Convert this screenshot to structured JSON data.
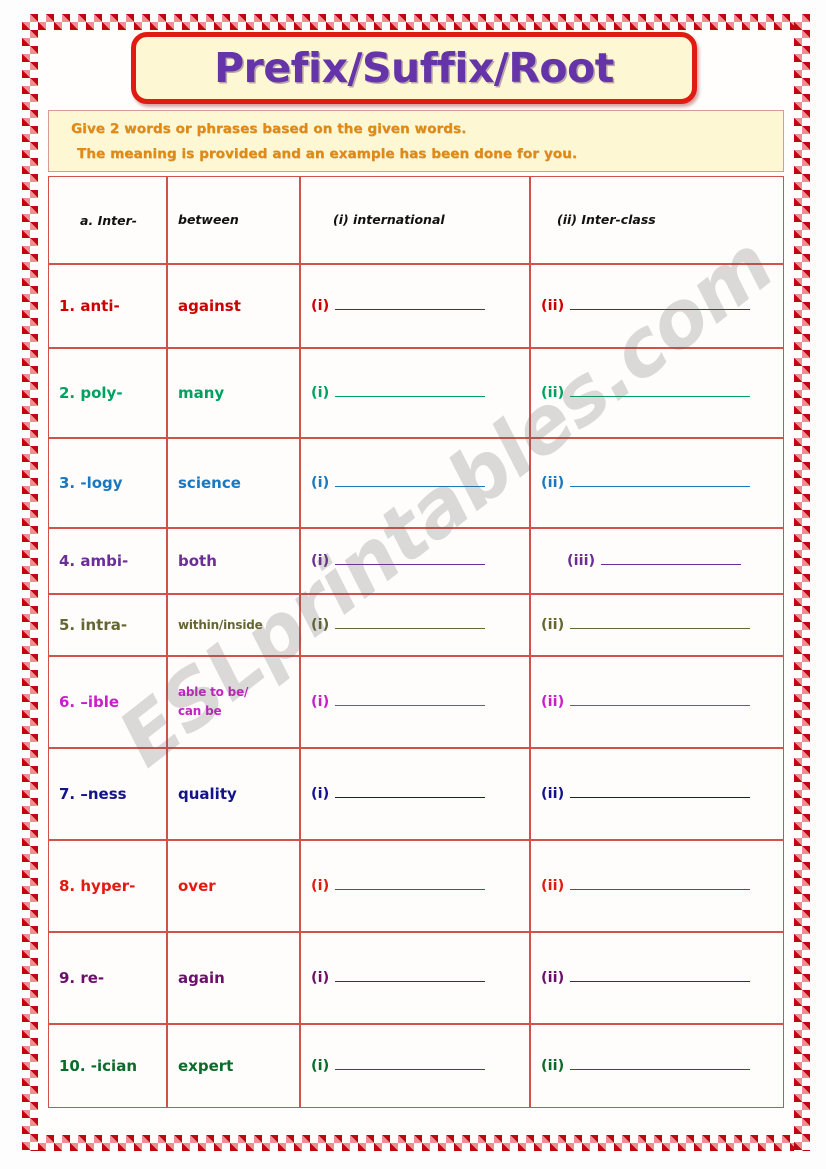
{
  "title": "Prefix/Suffix/Root",
  "instructions": {
    "line1": "Give 2 words or phrases based on the given words.",
    "line2": "The meaning is provided and an example has been done for you."
  },
  "watermark": "ESLprintables.com",
  "colors": {
    "title_purple": "#6434a8",
    "instruction_orange": "#e08a15",
    "banner_bg": "#fdf8d3",
    "banner_border": "#e01b12",
    "table_border": "#d0534a",
    "checker_dark": "#c00510",
    "checker_light": "#ef8f93"
  },
  "table": {
    "example_row": {
      "label": "a.  Inter-",
      "meaning": "between",
      "answer1": "(i)  international",
      "answer2": "(ii) Inter-class",
      "color": "#111111"
    },
    "rows": [
      {
        "number": "1. anti-",
        "meaning": "against",
        "marker1": "(i)",
        "marker2": "(ii)",
        "color": "#cc0000"
      },
      {
        "number": "2. poly-",
        "meaning": "many",
        "marker1": "(i)",
        "marker2": "(ii)",
        "color": "#00a060"
      },
      {
        "number": "3. -logy",
        "meaning": "science",
        "marker1": "(i)",
        "marker2": "(ii)",
        "color": "#1878c0"
      },
      {
        "number": "4. ambi-",
        "meaning": "both",
        "marker1": "(i)",
        "marker2": "(iii)",
        "color": "#6b2d96"
      },
      {
        "number": "5. intra-",
        "meaning": "within/inside",
        "marker1": "(i)",
        "marker2": "(ii)",
        "color": "#666633"
      },
      {
        "number": "6. –ible",
        "meaning": "able to be/\ncan be",
        "marker1": "(i)",
        "marker2": "(ii)",
        "color": "#c820c8"
      },
      {
        "number": "7. –ness",
        "meaning": "quality",
        "marker1": "(i)",
        "marker2": "(ii)",
        "color": "#13138c"
      },
      {
        "number": "8. hyper-",
        "meaning": "over",
        "marker1": "(i)",
        "marker2": "(ii)",
        "color": "#e01b12"
      },
      {
        "number": "9. re-",
        "meaning": "again",
        "marker1": "(i)",
        "marker2": "(ii)",
        "color": "#6b0f6b"
      },
      {
        "number": "10. -ician",
        "meaning": "expert",
        "marker1": "(i)",
        "marker2": "(ii)",
        "color": "#0a6b2a"
      }
    ]
  }
}
